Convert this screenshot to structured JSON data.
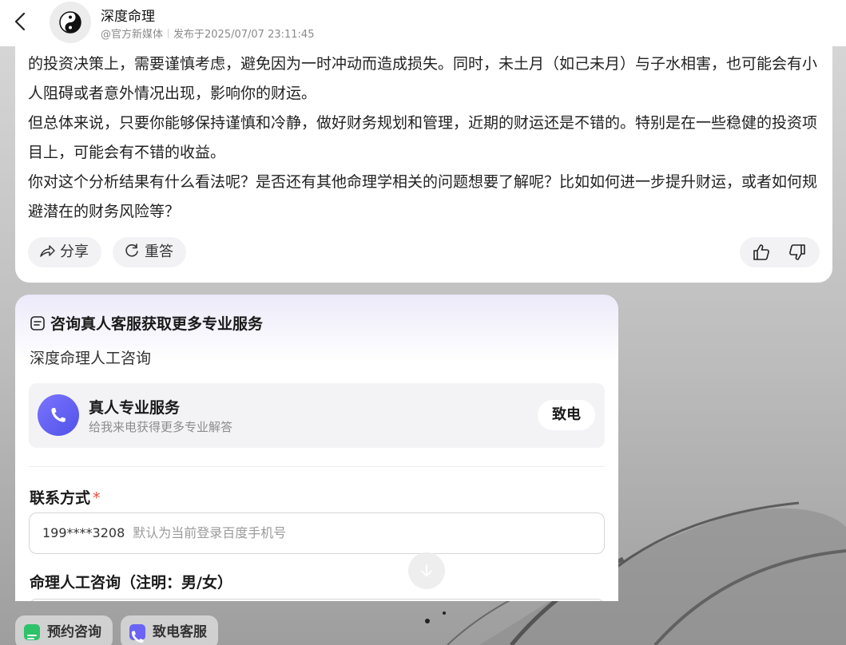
{
  "header": {
    "author_name": "深度命理",
    "author_handle": "@官方新媒体",
    "publish_time": "发布于2025/07/07 23:11:45"
  },
  "answer": {
    "paragraphs": [
      "的投资决策上，需要谨慎考虑，避免因为一时冲动而造成损失。同时，未土月（如己未月）与子水相害，也可能会有小人阻碍或者意外情况出现，影响你的财运。",
      "但总体来说，只要你能够保持谨慎和冷静，做好财务规划和管理，近期的财运还是不错的。特别是在一些稳健的投资项目上，可能会有不错的收益。",
      "你对这个分析结果有什么看法呢？是否还有其他命理学相关的问题想要了解呢？比如如何进一步提升财运，或者如何规避潜在的财务风险等？"
    ],
    "share_label": "分享",
    "regenerate_label": "重答"
  },
  "service": {
    "title": "咨询真人客服获取更多专业服务",
    "subtitle": "深度命理人工咨询",
    "call_title": "真人专业服务",
    "call_desc": "给我来电获得更多专业解答",
    "call_button": "致电",
    "contact_label": "联系方式",
    "required_mark": "*",
    "contact_value": "199****3208",
    "contact_placeholder": "默认为当前登录百度手机号",
    "gender_label": "命理人工咨询（注明：男/女）"
  },
  "bottom_bar": {
    "book_label": "预约咨询",
    "call_label": "致电客服"
  },
  "colors": {
    "accent_purple": "#5b57f0",
    "green": "#2ec26a",
    "required_red": "#f04a3a"
  },
  "icons": [
    "back-arrow-icon",
    "yin-yang-icon",
    "share-icon",
    "refresh-icon",
    "thumbs-up-icon",
    "thumbs-down-icon",
    "document-icon",
    "phone-icon",
    "arrow-down-icon"
  ]
}
